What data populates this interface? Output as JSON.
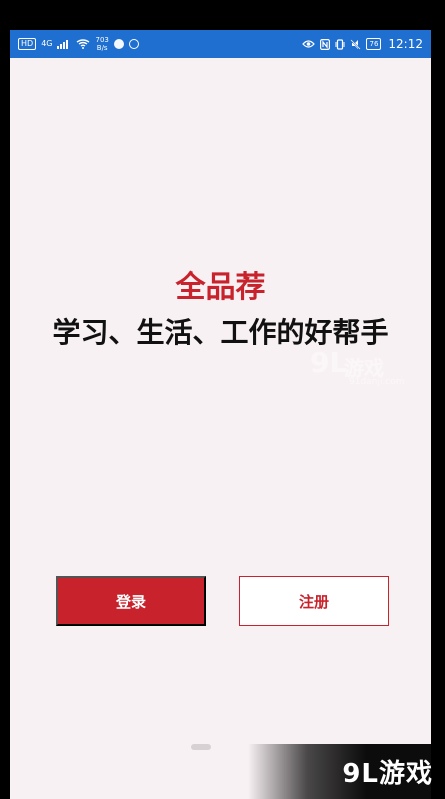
{
  "status_bar": {
    "hd": "HD",
    "signal_type": "4G",
    "network_speed_value": "703",
    "network_speed_unit": "B/s",
    "battery_level": "76",
    "time": "12:12"
  },
  "app": {
    "title": "全品荐",
    "slogan": "学习、生活、工作的好帮手"
  },
  "buttons": {
    "login_label": "登录",
    "register_label": "注册"
  },
  "watermark": {
    "logo": "9L",
    "text": "游戏",
    "url": "91danji.com"
  },
  "corner_brand": {
    "text": "9L游戏"
  },
  "colors": {
    "status_bar": "#1f6fd1",
    "brand_red": "#c8232c",
    "screen_bg": "#f8f1f4"
  }
}
